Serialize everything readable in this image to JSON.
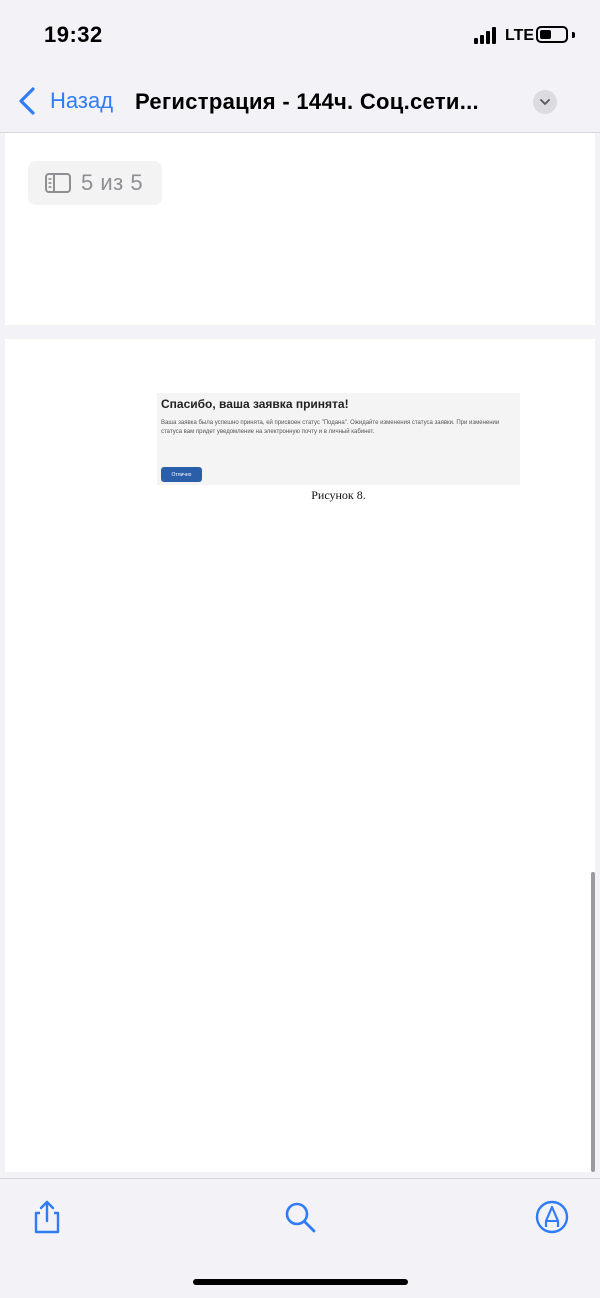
{
  "status_bar": {
    "time": "19:32",
    "network": "LTE"
  },
  "nav": {
    "back_label": "Назад",
    "title": "Регистрация - 144ч. Соц.сети..."
  },
  "page_indicator": {
    "text": "5 из 5"
  },
  "figure": {
    "title": "Спасибо, ваша заявка принята!",
    "body": "Ваша заявка была успешно принята, ей присвоен статус \"Подана\". Ожидайте изменения статуса заявки. При изменении статуса вам придет уведомление на электронную почту и в личный кабинет.",
    "button_label": "Отлично",
    "caption": "Рисунок 8."
  },
  "colors": {
    "accent": "#2f7cf6",
    "button": "#2b5ea8"
  },
  "icons": {
    "toolbar": [
      "share-icon",
      "search-icon",
      "markup-icon"
    ]
  }
}
